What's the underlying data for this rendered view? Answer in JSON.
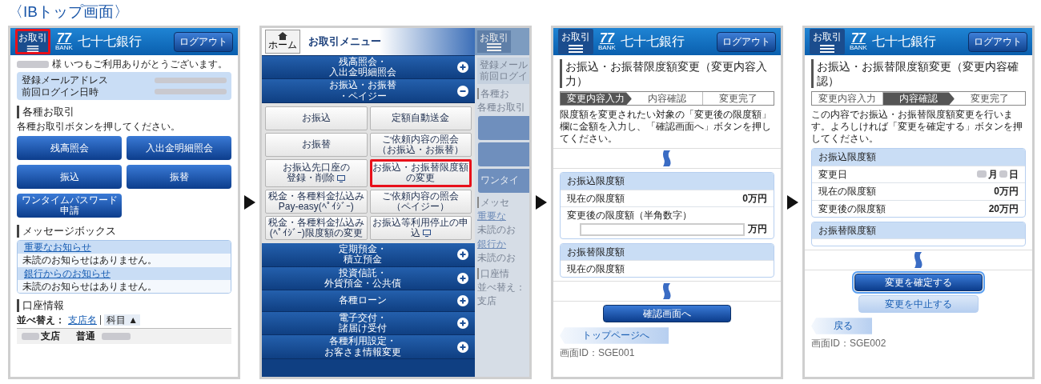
{
  "title": "〈IBトップ画面〉",
  "screens": [
    {
      "kind": "top",
      "header": {
        "menu_label": "お取引",
        "logo_number": "77",
        "logo_sub": "BANK",
        "bank_name": "七十七銀行",
        "logout": "ログアウト",
        "menu_highlighted": true
      },
      "greeting": "様 いつもご利用ありがとうございます。",
      "info_rows": [
        "登録メールアドレス",
        "前回ログイン日時"
      ],
      "transactions": {
        "heading": "各種お取引",
        "note": "各種お取引ボタンを押してください。",
        "buttons": [
          "残高照会",
          "入出金明細照会",
          "振込",
          "振替",
          "ワンタイムパスワード申請"
        ]
      },
      "messages": {
        "heading": "メッセージボックス",
        "groups": [
          {
            "link": "重要なお知らせ",
            "text": "未読のお知らせはありません。"
          },
          {
            "link": "銀行からのお知らせ",
            "text": "未読のお知らせはありません。"
          }
        ]
      },
      "accounts": {
        "heading": "口座情報",
        "sort_label": "並べ替え：",
        "sort_options": [
          {
            "label": "支店名",
            "selected": false
          },
          {
            "label": "科目 ▲",
            "selected": true
          }
        ],
        "rows": [
          {
            "branch": "支店",
            "type": "普通"
          }
        ]
      }
    },
    {
      "kind": "menu",
      "home_label": "ホーム",
      "title": "お取引メニュー",
      "sections": [
        {
          "lines": [
            "残高照会・",
            "入出金明細照会"
          ],
          "expanded": false
        },
        {
          "lines": [
            "お振込・お振替",
            "・ペイジー"
          ],
          "expanded": true,
          "items": [
            {
              "lines": [
                "お振込"
              ],
              "pc_icon": false,
              "highlighted": false
            },
            {
              "lines": [
                "定額自動送金"
              ],
              "pc_icon": false,
              "highlighted": false
            },
            {
              "lines": [
                "お振替"
              ],
              "pc_icon": false,
              "highlighted": false
            },
            {
              "lines": [
                "ご依頼内容の照会",
                "（お振込・お振替）"
              ],
              "pc_icon": false,
              "highlighted": false
            },
            {
              "lines": [
                "お振込先口座の",
                "登録・削除"
              ],
              "pc_icon": true,
              "highlighted": false
            },
            {
              "lines": [
                "お振込・お振替限度額",
                "の変更"
              ],
              "pc_icon": false,
              "highlighted": true
            },
            {
              "lines": [
                "税金・各種料金払込み",
                "Pay-easy(ﾍﾟｲｼﾞｰ)"
              ],
              "pc_icon": false,
              "highlighted": false
            },
            {
              "lines": [
                "ご依頼内容の照会",
                "（ペイジー）"
              ],
              "pc_icon": false,
              "highlighted": false
            },
            {
              "lines": [
                "税金・各種料金払込み",
                "(ﾍﾟｲｼﾞｰ)限度額の変更"
              ],
              "pc_icon": false,
              "highlighted": false
            },
            {
              "lines": [
                "お振込等利用停止の申",
                "込"
              ],
              "pc_icon": true,
              "highlighted": false
            }
          ]
        },
        {
          "lines": [
            "定期預金・",
            "積立預金"
          ],
          "expanded": false
        },
        {
          "lines": [
            "投資信託・",
            "外貨預金・公共債"
          ],
          "expanded": false
        },
        {
          "lines": [
            "各種ローン"
          ],
          "expanded": false
        },
        {
          "lines": [
            "電子交付・",
            "諸届け受付"
          ],
          "expanded": false
        },
        {
          "lines": [
            "各種利用設定・",
            "お客さま情報変更"
          ],
          "expanded": false
        }
      ],
      "backdrop": [
        {
          "kind": "header",
          "text": "お取引"
        },
        {
          "kind": "info",
          "lines": [
            "登録メール",
            "前回ログイ"
          ]
        },
        {
          "kind": "heading",
          "text": "各種お"
        },
        {
          "kind": "text",
          "text": "各種お取引"
        },
        {
          "kind": "button"
        },
        {
          "kind": "button"
        },
        {
          "kind": "button",
          "text": "ワンタイ"
        },
        {
          "kind": "heading",
          "text": "メッセ"
        },
        {
          "kind": "link",
          "text": "重要な"
        },
        {
          "kind": "text",
          "text": "未読のお"
        },
        {
          "kind": "link",
          "text": "銀行か"
        },
        {
          "kind": "text",
          "text": "未読のお"
        },
        {
          "kind": "heading",
          "text": "口座情"
        },
        {
          "kind": "text",
          "text": "並べ替え："
        },
        {
          "kind": "text",
          "text": "支店"
        }
      ]
    },
    {
      "kind": "form",
      "header": {
        "menu_label": "お取引",
        "logo_number": "77",
        "logo_sub": "BANK",
        "bank_name": "七十七銀行",
        "logout": "ログアウト",
        "menu_highlighted": false
      },
      "title": "お振込・お振替限度額変更（変更内容入力）",
      "steps": [
        {
          "label": "変更内容入力",
          "selected": true
        },
        {
          "label": "内容確認",
          "selected": false
        },
        {
          "label": "変更完了",
          "selected": false
        }
      ],
      "instruction": "限度額を変更されたい対象の「変更後の限度額」欄に金額を入力し、「確認画面へ」ボタンを押してください。",
      "break_after_instruction": true,
      "cards": [
        {
          "title": "お振込限度額",
          "rows": [
            {
              "kind": "value",
              "label": "現在の限度額",
              "value": "0万円"
            },
            {
              "kind": "input",
              "label": "変更後の限度額（半角数字）",
              "unit": "万円"
            }
          ]
        },
        {
          "title": "お振替限度額",
          "rows": [
            {
              "kind": "value",
              "label": "現在の限度額"
            }
          ]
        }
      ],
      "break_after_cards": true,
      "buttons": [
        {
          "label": "確認画面へ",
          "kind": "primary",
          "focused": false
        }
      ],
      "back": "トップページへ",
      "screen_id": "画面ID：SGE001"
    },
    {
      "kind": "form",
      "header": {
        "menu_label": "お取引",
        "logo_number": "77",
        "logo_sub": "BANK",
        "bank_name": "七十七銀行",
        "logout": "ログアウト",
        "menu_highlighted": false
      },
      "title": "お振込・お振替限度額変更（変更内容確認）",
      "steps": [
        {
          "label": "変更内容入力",
          "selected": false
        },
        {
          "label": "内容確認",
          "selected": true
        },
        {
          "label": "変更完了",
          "selected": false
        }
      ],
      "instruction": "この内容でお振込・お振替限度額変更を行います。よろしければ「変更を確定する」ボタンを押してください。",
      "break_after_instruction": false,
      "cards": [
        {
          "title": "お振込限度額",
          "rows": [
            {
              "kind": "date",
              "label": "変更日",
              "month": "月",
              "day": "日"
            },
            {
              "kind": "value",
              "label": "現在の限度額",
              "value": "0万円"
            },
            {
              "kind": "value",
              "label": "変更後の限度額",
              "value": "20万円"
            }
          ]
        },
        {
          "title": "お振替限度額"
        }
      ],
      "break_after_cards": true,
      "buttons": [
        {
          "label": "変更を確定する",
          "kind": "primary",
          "focused": true
        },
        {
          "label": "変更を中止する",
          "kind": "secondary",
          "focused": false
        }
      ],
      "back": "戻る",
      "screen_id": "画面ID：SGE002"
    }
  ]
}
